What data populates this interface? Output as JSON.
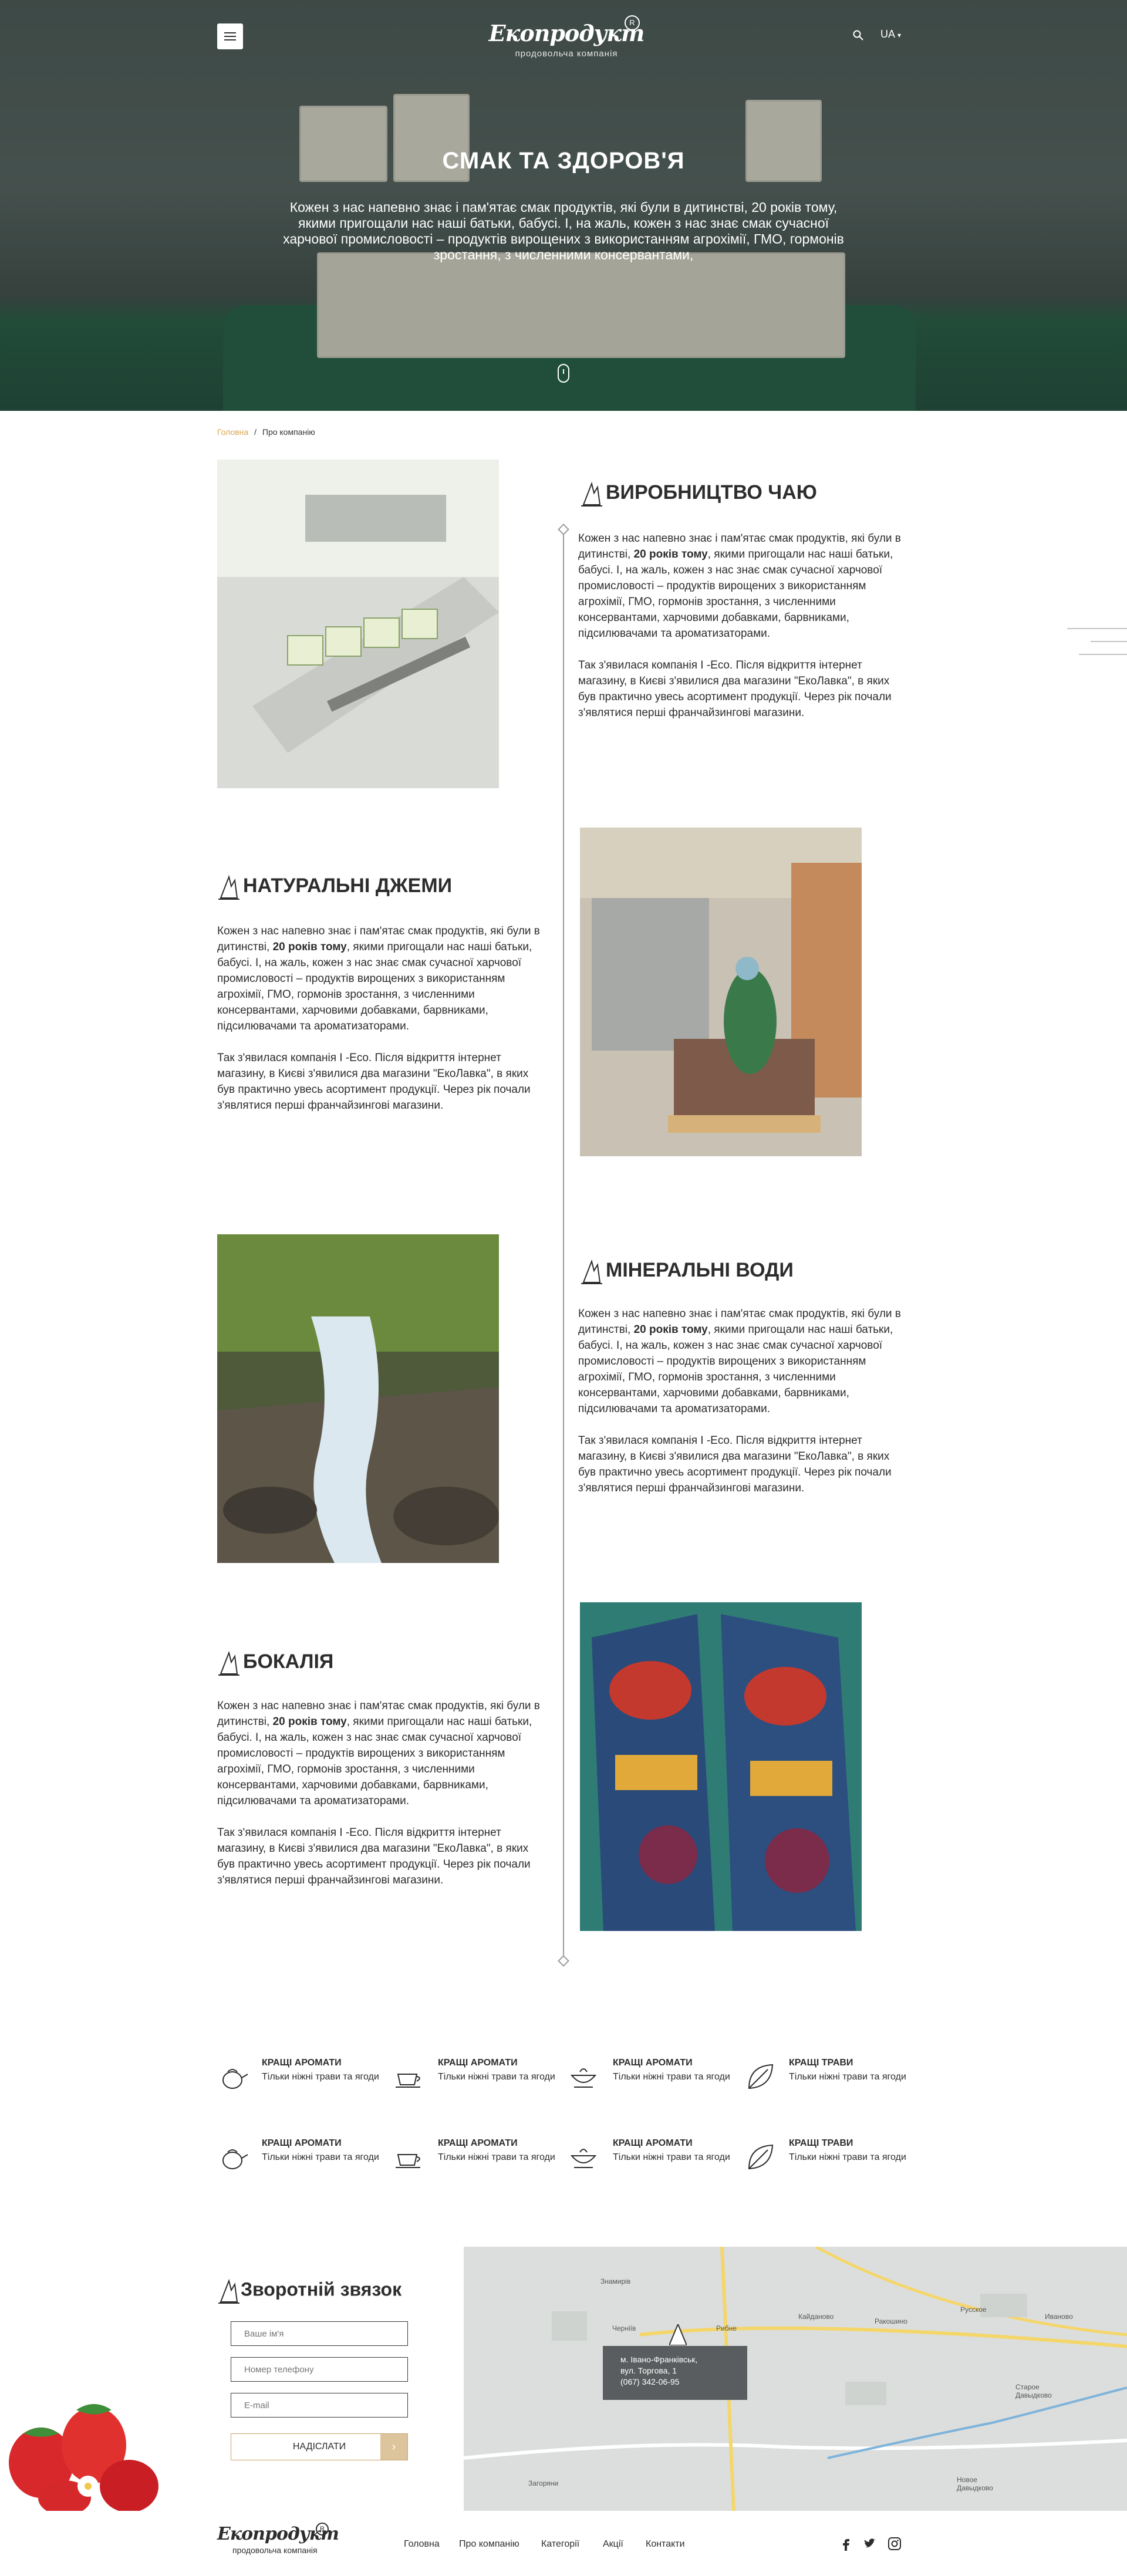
{
  "header": {
    "menu_icon": "hamburger-icon",
    "logo_name": "Екопродукт",
    "logo_sub": "продовольча компанія",
    "logo_reg": "R",
    "search_icon": "search-icon",
    "lang": "UA"
  },
  "hero": {
    "title": "СМАК ТА ЗДОРОВ'Я",
    "text": "Кожен з нас напевно знає і пам'ятає смак продуктів, які були в дитинстві, 20 років тому, якими пригощали нас наші батьки, бабусі. І, на жаль, кожен з нас знає смак сучасної харчової промисловості – продуктів вирощених з використанням агрохімії, ГМО, гормонів зростання, з численними консервантами,"
  },
  "breadcrumb": {
    "home": "Головна",
    "separator": "/",
    "current": "Про компанію"
  },
  "sections": [
    {
      "title": "ВИРОБНИЦТВО ЧАЮ",
      "p1_a": "Кожен з нас напевно знає і пам'ятає смак продуктів, які були в дитинстві, ",
      "p1_b": "20 років тому",
      "p1_c": ", якими пригощали нас наші батьки, бабусі. І, на жаль, кожен з нас знає смак сучасної харчової промисловості – продуктів вирощених з використанням агрохімії, ГМО, гормонів зростання, з численними консервантами, харчовими добавками, барвниками, підсилювачами та ароматизаторами.",
      "p2": "Так з'явилася компанія I -Eco. Після відкриття інтернет магазину, в Києві з'явилися два магазини \"ЕкоЛавка\", в яких був практично увесь асортимент продукції. Через рік почали з'являтися перші франчайзингові магазини."
    },
    {
      "title": "НАТУРАЛЬНІ ДЖЕМИ",
      "p1_a": "Кожен з нас напевно знає і пам'ятає смак продуктів, які були в дитинстві, ",
      "p1_b": "20 років тому",
      "p1_c": ", якими пригощали нас наші батьки, бабусі. І, на жаль, кожен з нас знає смак сучасної харчової промисловості – продуктів вирощених з використанням агрохімії, ГМО, гормонів зростання, з численними консервантами, харчовими добавками, барвниками, підсилювачами та ароматизаторами.",
      "p2": "Так з'явилася компанія I -Eco. Після відкриття інтернет магазину, в Києві з'явилися два магазини \"ЕкоЛавка\", в яких був практично увесь асортимент продукції. Через рік почали з'являтися перші франчайзингові магазини."
    },
    {
      "title": "МІНЕРАЛЬНІ ВОДИ",
      "p1_a": "Кожен з нас напевно знає і пам'ятає смак продуктів, які були в дитинстві, ",
      "p1_b": "20 років тому",
      "p1_c": ", якими пригощали нас наші батьки, бабусі. І, на жаль, кожен з нас знає смак сучасної харчової промисловості – продуктів вирощених з використанням агрохімії, ГМО, гормонів зростання, з численними консервантами, харчовими добавками, барвниками, підсилювачами та ароматизаторами.",
      "p2": "Так з'явилася компанія I -Eco. Після відкриття інтернет магазину, в Києві з'явилися два магазини \"ЕкоЛавка\", в яких був практично увесь асортимент продукції. Через рік почали з'являтися перші франчайзингові магазини."
    },
    {
      "title": "БОКАЛІЯ",
      "p1_a": "Кожен з нас напевно знає і пам'ятає смак продуктів, які були в дитинстві, ",
      "p1_b": "20 років тому",
      "p1_c": ", якими пригощали нас наші батьки, бабусі. І, на жаль, кожен з нас знає смак сучасної харчової промисловості – продуктів вирощених з використанням агрохімії, ГМО, гормонів зростання, з численними консервантами, харчовими добавками, барвниками, підсилювачами та ароматизаторами.",
      "p2": "Так з'явилася компанія I -Eco. Після відкриття інтернет магазину, в Києві з'явилися два магазини \"ЕкоЛавка\", в яких був практично увесь асортимент продукції. Через рік почали з'являтися перші франчайзингові магазини."
    }
  ],
  "features": [
    {
      "title": "КРАЩІ АРОМАТИ",
      "text": "Тільки ніжні трави та ягоди",
      "icon": "teapot-icon"
    },
    {
      "title": "КРАЩІ АРОМАТИ",
      "text": "Тільки ніжні трави та ягоди",
      "icon": "tea-cup-icon"
    },
    {
      "title": "КРАЩІ АРОМАТИ",
      "text": "Тільки ніжні трави та ягоди",
      "icon": "tea-bowl-icon"
    },
    {
      "title": "КРАЩІ ТРАВИ",
      "text": "Тільки ніжні трави та ягоди",
      "icon": "leaf-icon"
    },
    {
      "title": "КРАЩІ АРОМАТИ",
      "text": "Тільки ніжні трави та ягоди",
      "icon": "teapot-icon"
    },
    {
      "title": "КРАЩІ АРОМАТИ",
      "text": "Тільки ніжні трави та ягоди",
      "icon": "tea-cup-icon"
    },
    {
      "title": "КРАЩІ АРОМАТИ",
      "text": "Тільки ніжні трави та ягоди",
      "icon": "tea-bowl-icon"
    },
    {
      "title": "КРАЩІ ТРАВИ",
      "text": "Тільки ніжні трави та ягоди",
      "icon": "leaf-icon"
    }
  ],
  "contact": {
    "title": "Зворотній звязок",
    "name_placeholder": "Ваше ім'я",
    "phone_placeholder": "Номер телефону",
    "email_placeholder": "E-mail",
    "submit_label": "НАДІСЛАТИ",
    "submit_arrow": "›"
  },
  "map": {
    "address_line1": "м. Івано-Франківськ,",
    "address_line2": "вул. Торгова, 1",
    "phone": "(067) 342-06-95",
    "labels": [
      "Знамирів",
      "Черніїв",
      "Рибне",
      "Кайданово",
      "Ракошино",
      "Русское",
      "Иваново",
      "Старое Давыдково",
      "Новое Давыдково",
      "Загоряни"
    ]
  },
  "footer": {
    "logo_name": "Екопродукт",
    "logo_sub": "продовольча компанія",
    "logo_reg": "R",
    "nav": [
      "Головна",
      "Про компанію",
      "Категорії",
      "Акції",
      "Контакти"
    ],
    "social": [
      "facebook-icon",
      "twitter-icon",
      "instagram-icon"
    ]
  },
  "colors": {
    "accent": "#d9a64e",
    "text": "#2d2d2d",
    "map_info_bg": "#5a5d5f",
    "hero_green": "#1d5f3f"
  }
}
